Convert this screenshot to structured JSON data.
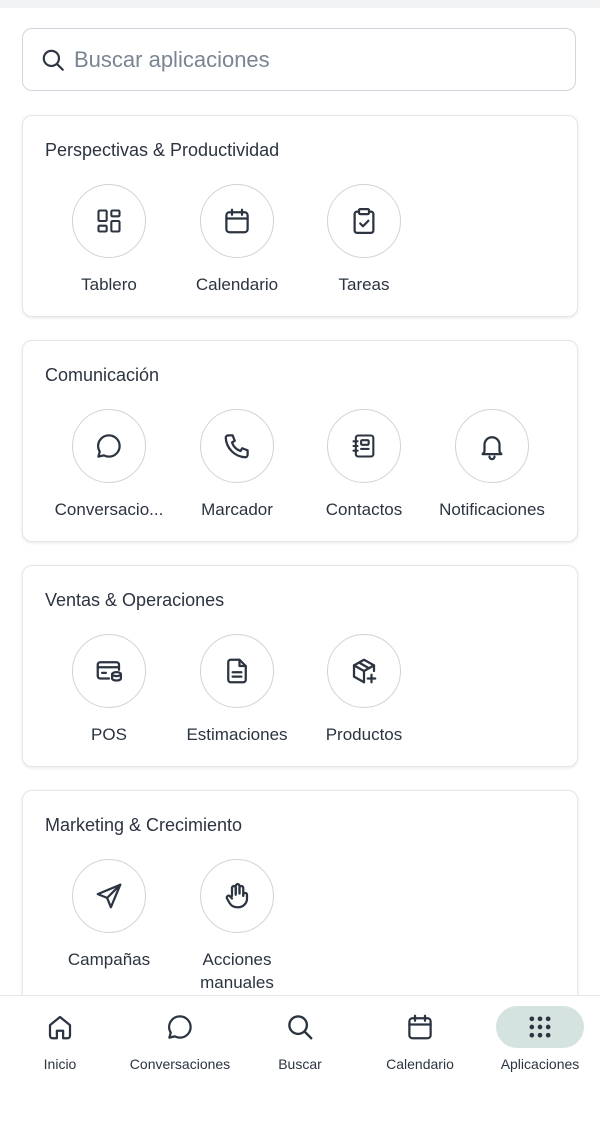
{
  "search": {
    "placeholder": "Buscar aplicaciones"
  },
  "sections": [
    {
      "title": "Perspectivas & Productividad",
      "apps": [
        {
          "label": "Tablero",
          "icon": "dashboard-icon"
        },
        {
          "label": "Calendario",
          "icon": "calendar-icon"
        },
        {
          "label": "Tareas",
          "icon": "clipboard-check-icon"
        }
      ]
    },
    {
      "title": "Comunicación",
      "apps": [
        {
          "label": "Conversacio...",
          "icon": "chat-bubble-icon"
        },
        {
          "label": "Marcador",
          "icon": "phone-icon"
        },
        {
          "label": "Contactos",
          "icon": "address-book-icon"
        },
        {
          "label": "Notificaciones",
          "icon": "bell-icon"
        }
      ]
    },
    {
      "title": "Ventas & Operaciones",
      "apps": [
        {
          "label": "POS",
          "icon": "pos-card-icon"
        },
        {
          "label": "Estimaciones",
          "icon": "document-icon"
        },
        {
          "label": "Productos",
          "icon": "box-plus-icon"
        }
      ]
    },
    {
      "title": "Marketing & Crecimiento",
      "apps": [
        {
          "label": "Campañas",
          "icon": "send-icon"
        },
        {
          "label": "Acciones manuales",
          "icon": "hand-icon"
        }
      ]
    }
  ],
  "bottom_nav": [
    {
      "label": "Inicio",
      "icon": "home-icon"
    },
    {
      "label": "Conversaciones",
      "icon": "chat-bubble-icon"
    },
    {
      "label": "Buscar",
      "icon": "search-icon"
    },
    {
      "label": "Calendario",
      "icon": "calendar-icon"
    },
    {
      "label": "Aplicaciones",
      "icon": "grid-dots-icon",
      "active": true
    }
  ],
  "colors": {
    "active_nav_bg": "#d4e3df",
    "text": "#2b3440",
    "border": "#cfd4d9"
  }
}
